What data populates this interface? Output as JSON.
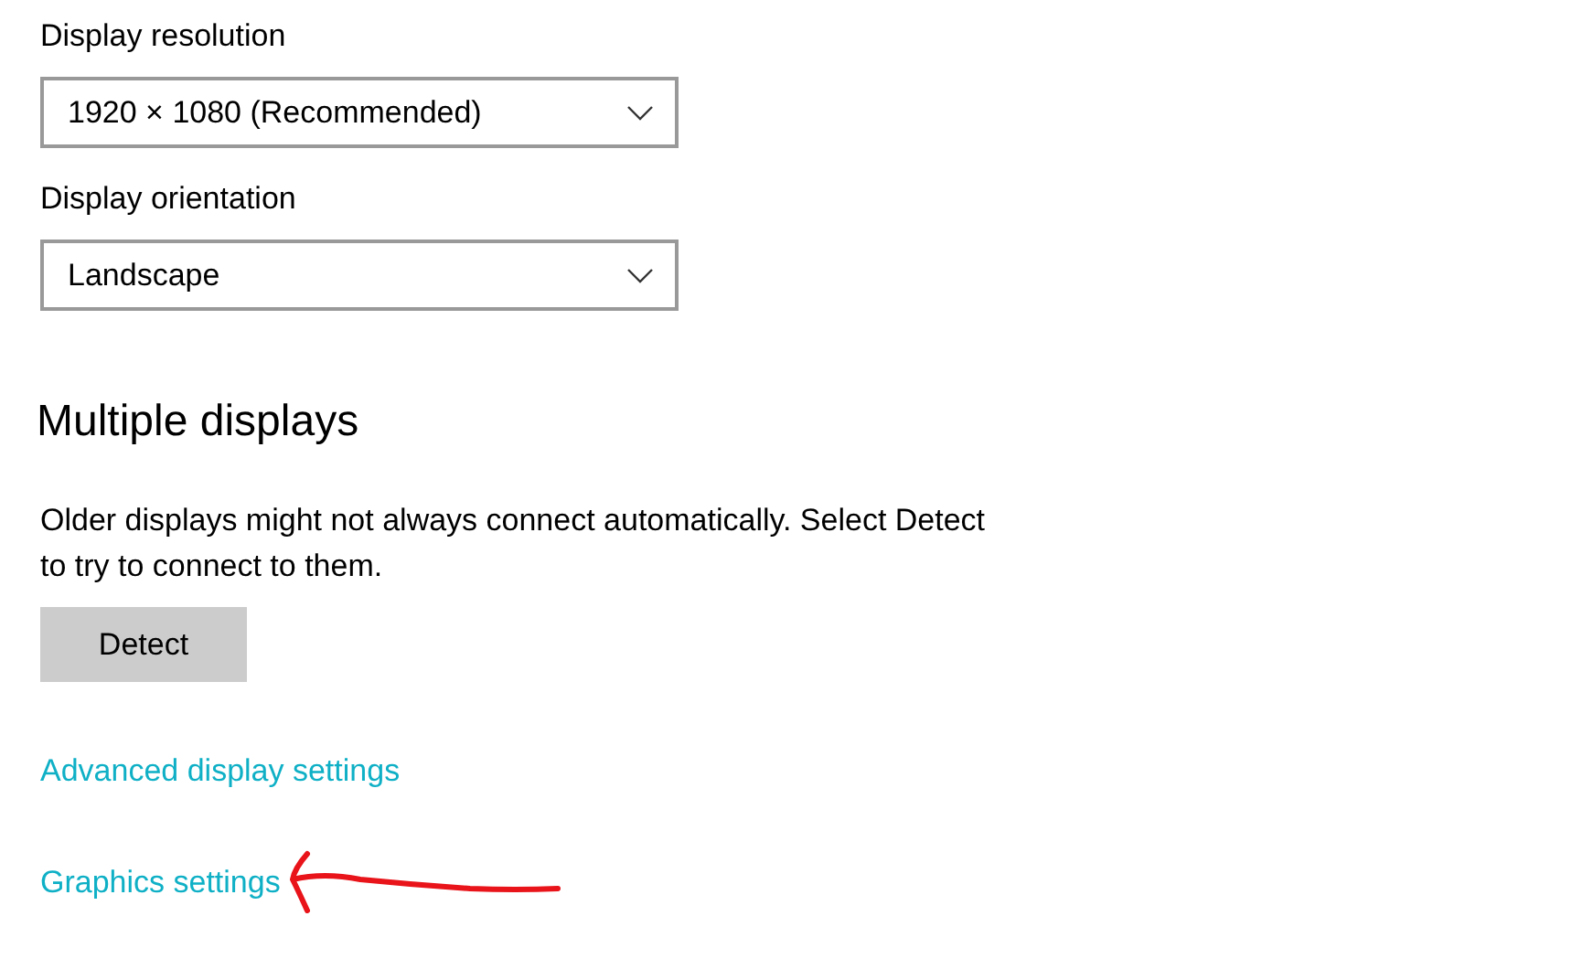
{
  "dropdowns": [
    {
      "label": "Display resolution",
      "value": "1920 × 1080 (Recommended)"
    },
    {
      "label": "Display orientation",
      "value": "Landscape"
    }
  ],
  "section": {
    "title": "Multiple displays",
    "description": "Older displays might not always connect automatically. Select Detect to try to connect to them.",
    "button": "Detect"
  },
  "links": [
    {
      "label": "Advanced display settings"
    },
    {
      "label": "Graphics settings",
      "annotation": {
        "kind": "arrow"
      }
    }
  ]
}
